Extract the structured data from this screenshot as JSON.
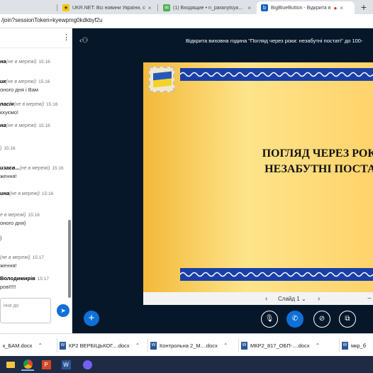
{
  "browser": {
    "tabs": [
      {
        "label": "UKR.NET: Всі новини України, с",
        "favicon": "ukrnet-icon",
        "active": false
      },
      {
        "label": "(1) Входящие • n_paranytsya@u",
        "favicon": "mail-icon",
        "active": false
      },
      {
        "label": "BigBlueButton - Відкрита в",
        "favicon": "bigbluebutton-icon",
        "active": true
      }
    ],
    "new_tab_label": "+",
    "url": "/join?sessionToken=kyewpmg0kdkbyf2u"
  },
  "chat": {
    "menu_icon": "⋮",
    "messages": [
      {
        "name": "на",
        "offline": "(не в мережі)",
        "time": "15:16",
        "text": ""
      },
      {
        "name": "ик",
        "offline": "(не в мережі)",
        "time": "15:16",
        "text": "оного дня і Вам"
      },
      {
        "name": "пасія",
        "offline": "(не в мережі)",
        "time": "15:16",
        "text": "кхуємо!"
      },
      {
        "name": "на",
        "offline": "(не в мережі)",
        "time": "15:16",
        "text": ""
      },
      {
        "name": "",
        "offline": ")",
        "time": "15:16",
        "text": ""
      },
      {
        "name": "изаєв...",
        "offline": "(не в мережі)",
        "time": "15:16",
        "text": "ження!"
      },
      {
        "name": "ина",
        "offline": "(не в мережі)",
        "time": "15:16",
        "text": ""
      },
      {
        "name": "",
        "offline": "е в мережі)",
        "time": "15:16",
        "text": "оного дня)"
      },
      {
        "name": "",
        "offline": "",
        "time": "",
        "text": ")"
      },
      {
        "name": "",
        "offline": "(не в мережі)",
        "time": "15:17",
        "text": "ження!"
      },
      {
        "name": "Володимирів",
        "offline": "",
        "time": "15:17",
        "text": "ровї!!!!"
      }
    ],
    "input_placeholder": "ння до",
    "send_icon": "➤"
  },
  "meeting": {
    "title": "Відкрита виховна година \"Погляд через роки: незабутні постаті\" до 100-",
    "slide": {
      "title_line1": "ПОГЛЯД ЧЕРЕЗ РОКИ",
      "title_line2": "НЕЗАБУТНІ ПОСТАТ"
    },
    "slide_nav": {
      "prev": "‹",
      "label": "Слайд 1",
      "caret": "⌄",
      "next": "›",
      "zoom": "−"
    },
    "actions_label": "+",
    "controls": [
      {
        "name": "mute-mic-icon",
        "glyph": "🎙"
      },
      {
        "name": "phone-icon",
        "glyph": "✆"
      },
      {
        "name": "camera-off-icon",
        "glyph": "⊘"
      },
      {
        "name": "screen-share-icon",
        "glyph": "⧉"
      }
    ]
  },
  "downloads": [
    {
      "name": "к_БАМ.docx"
    },
    {
      "name": "КР2 ВЕРБІЦЬКОГ....docx"
    },
    {
      "name": "Контрольна 2_М....docx"
    },
    {
      "name": "МКР2_817_ОБП-....docx"
    },
    {
      "name": "мкр_б"
    }
  ],
  "taskbar": {
    "apps": [
      "file-explorer-icon",
      "chrome-icon",
      "powerpoint-icon",
      "word-icon",
      "viber-icon"
    ]
  },
  "colors": {
    "accent": "#0f70d7",
    "dark_bg": "#06172a"
  }
}
